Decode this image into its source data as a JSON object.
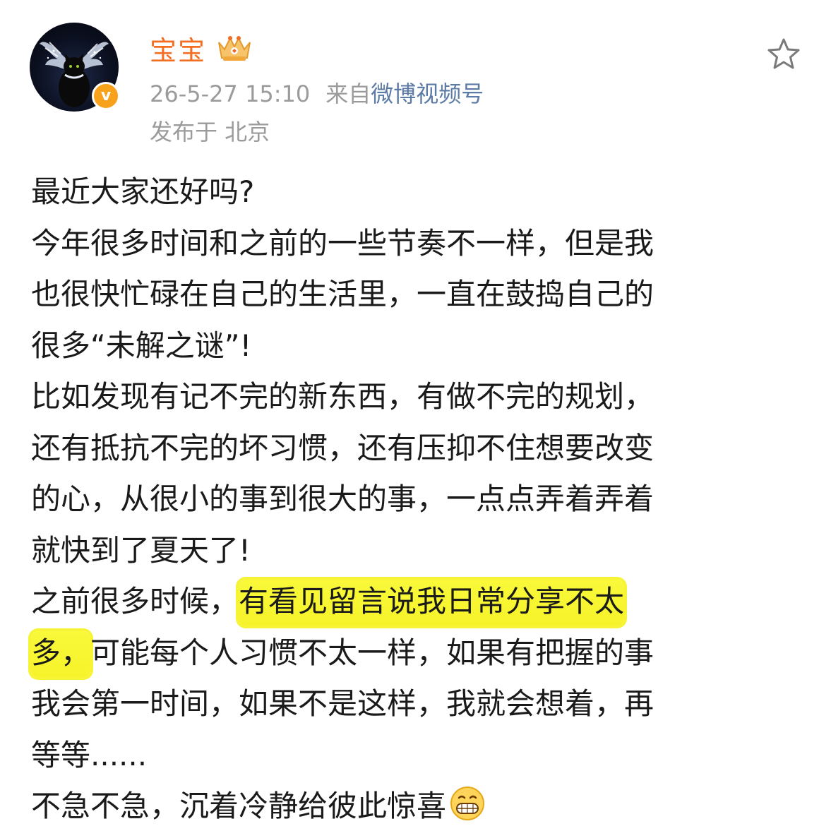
{
  "post": {
    "username": "宝宝",
    "timestamp": "26-5-27 15:10",
    "source_prefix": "来自",
    "source_name": "微博视频号",
    "location": "发布于 北京",
    "verified_mark": "v",
    "icons": {
      "crown": "crown-badge-icon",
      "favorite": "star-outline-icon",
      "emoji": "grinning-face-icon"
    },
    "highlight_color": "#f7f436",
    "name_color": "#f36e22",
    "body_lines": [
      "最近大家还好吗?",
      "今年很多时间和之前的一些节奏不一样，但是我",
      "也很快忙碌在自己的生活里，一直在鼓捣自己的",
      "很多“未解之谜”!",
      "比如发现有记不完的新东西，有做不完的规划，",
      "还有抵抗不完的坏习惯，还有压抑不住想要改变",
      "的心，从很小的事到很大的事，一点点弄着弄着",
      "就快到了夏天了!"
    ],
    "line9_plain": "之前很多时候，",
    "line9_highlight": "有看见留言说我日常分享不太",
    "line10_highlight": "多，",
    "line10_plain": "可能每个人习惯不太一样，如果有把握的事",
    "body_lines_after": [
      "我会第一时间，如果不是这样，我就会想着，再",
      "等等......"
    ],
    "last_line": "不急不急，沉着冷静给彼此惊喜"
  }
}
